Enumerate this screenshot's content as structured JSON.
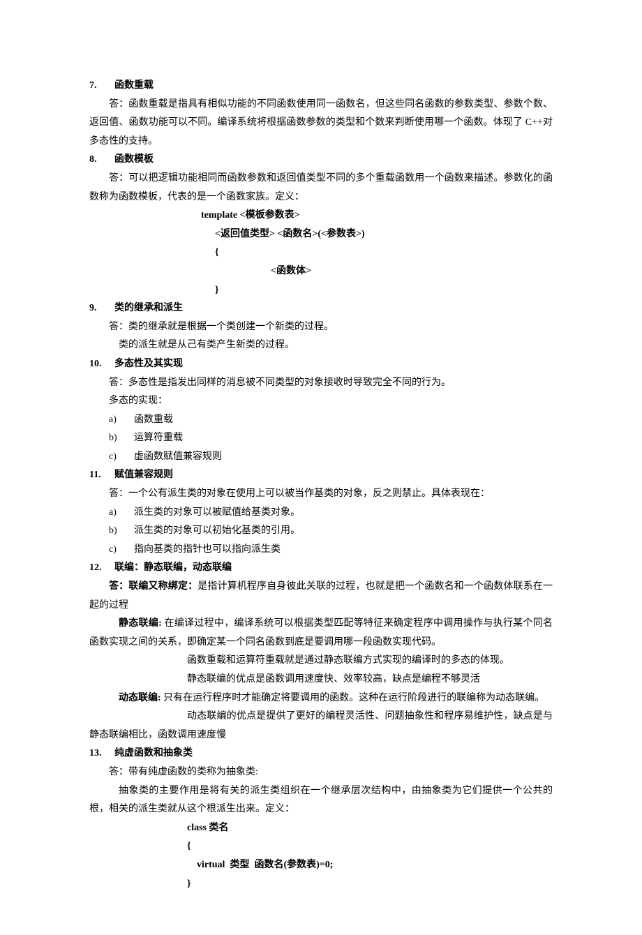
{
  "items": [
    {
      "num": "7.",
      "title": "函数重载",
      "body": [
        {
          "type": "ans",
          "text": "答：函数重载是指具有相似功能的不同函数使用同一函数名，但这些同名函数的参数类型、参数个数、返回值、函数功能可以不同。编译系统将根据函数参数的类型和个数来判断使用哪一个函数。体现了 C++对多态性的支持。"
        }
      ]
    },
    {
      "num": "8.",
      "title": "函数模板",
      "body": [
        {
          "type": "ans",
          "text": "答：可以把逻辑功能相同而函数参数和返回值类型不同的多个重载函数用一个函数来描述。参数化的函数称为函数模板，代表的是一个函数家族。定义："
        },
        {
          "type": "code1",
          "text": "template <模板参数表>"
        },
        {
          "type": "code2",
          "text": "<返回值类型> <函数名>(<参数表>)"
        },
        {
          "type": "code2",
          "text": "{"
        },
        {
          "type": "code3",
          "text": "<函数体>"
        },
        {
          "type": "code2",
          "text": "}"
        }
      ]
    },
    {
      "num": "9.",
      "title": "类的继承和派生",
      "body": [
        {
          "type": "noind",
          "text": "答：类的继承就是根据一个类创建一个新类的过程。"
        },
        {
          "type": "indent3",
          "text": "类的派生就是从己有类产生新类的过程。"
        }
      ]
    },
    {
      "num": "10.",
      "title": "多态性及其实现",
      "body": [
        {
          "type": "noind",
          "text": "答：多态性是指发出同样的消息被不同类型的对象接收时导致完全不同的行为。"
        },
        {
          "type": "noind",
          "text": "多态的实现："
        },
        {
          "type": "sub",
          "letter": "a)",
          "text": "函数重载"
        },
        {
          "type": "sub",
          "letter": "b)",
          "text": "运算符重载"
        },
        {
          "type": "sub",
          "letter": "c)",
          "text": "虚函数赋值兼容规则"
        }
      ]
    },
    {
      "num": "11.",
      "title": "赋值兼容规则",
      "body": [
        {
          "type": "noind",
          "text": "答：一个公有派生类的对象在使用上可以被当作基类的对象，反之则禁止。具体表现在："
        },
        {
          "type": "sub",
          "letter": "a)",
          "text": "派生类的对象可以被赋值给基类对象。"
        },
        {
          "type": "sub",
          "letter": "b)",
          "text": "派生类的对象可以初始化基类的引用。"
        },
        {
          "type": "sub",
          "letter": "c)",
          "text": "指向基类的指针也可以指向派生类"
        }
      ]
    },
    {
      "num": "12.",
      "title": "联编：静态联编，动态联编",
      "body": [
        {
          "type": "ans_bold",
          "bold": "答：联编又称绑定：",
          "rest": "是指计算机程序自身彼此关联的过程，也就是把一个函数名和一个函数体联系在一起的过程"
        },
        {
          "type": "indent3_bold",
          "bold": "静态联编:",
          "rest": " 在编译过程中，编译系统可以根据类型匹配等特征来确定程序中调用操作与执行某个同名函数实现之间的关系，即确定某一个同名函数到底是要调用哪一段函数实现代码。"
        },
        {
          "type": "indent6",
          "text": "函数重载和运算符重载就是通过静态联编方式实现的编译时的多态的体现。"
        },
        {
          "type": "indent6",
          "text": "静态联编的优点是函数调用速度快、效率较高，缺点是编程不够灵活"
        },
        {
          "type": "indent3_bold",
          "bold": "动态联编:",
          "rest": " 只有在运行程序时才能确定将要调用的函数。这种在运行阶段进行的联编称为动态联编。"
        },
        {
          "type": "indent6_wrap",
          "text": "动态联编的优点是提供了更好的编程灵活性、问题抽象性和程序易维护性，缺点是与静态联编相比，函数调用速度慢"
        }
      ]
    },
    {
      "num": "13.",
      "title": "纯虚函数和抽象类",
      "body": [
        {
          "type": "noind",
          "text": "答：带有纯虚函数的类称为抽象类:"
        },
        {
          "type": "indent3_wrap",
          "text": "抽象类的主要作用是将有关的派生类组织在一个继承层次结构中，由抽象类为它们提供一个公共的根，相关的派生类就从这个根派生出来。定义："
        },
        {
          "type": "code1b",
          "text": "class  类名"
        },
        {
          "type": "code1b",
          "text": "{"
        },
        {
          "type": "code2b",
          "text": "    virtual  类型  函数名(参数表)=0;"
        },
        {
          "type": "code1b",
          "text": "}"
        }
      ]
    }
  ]
}
